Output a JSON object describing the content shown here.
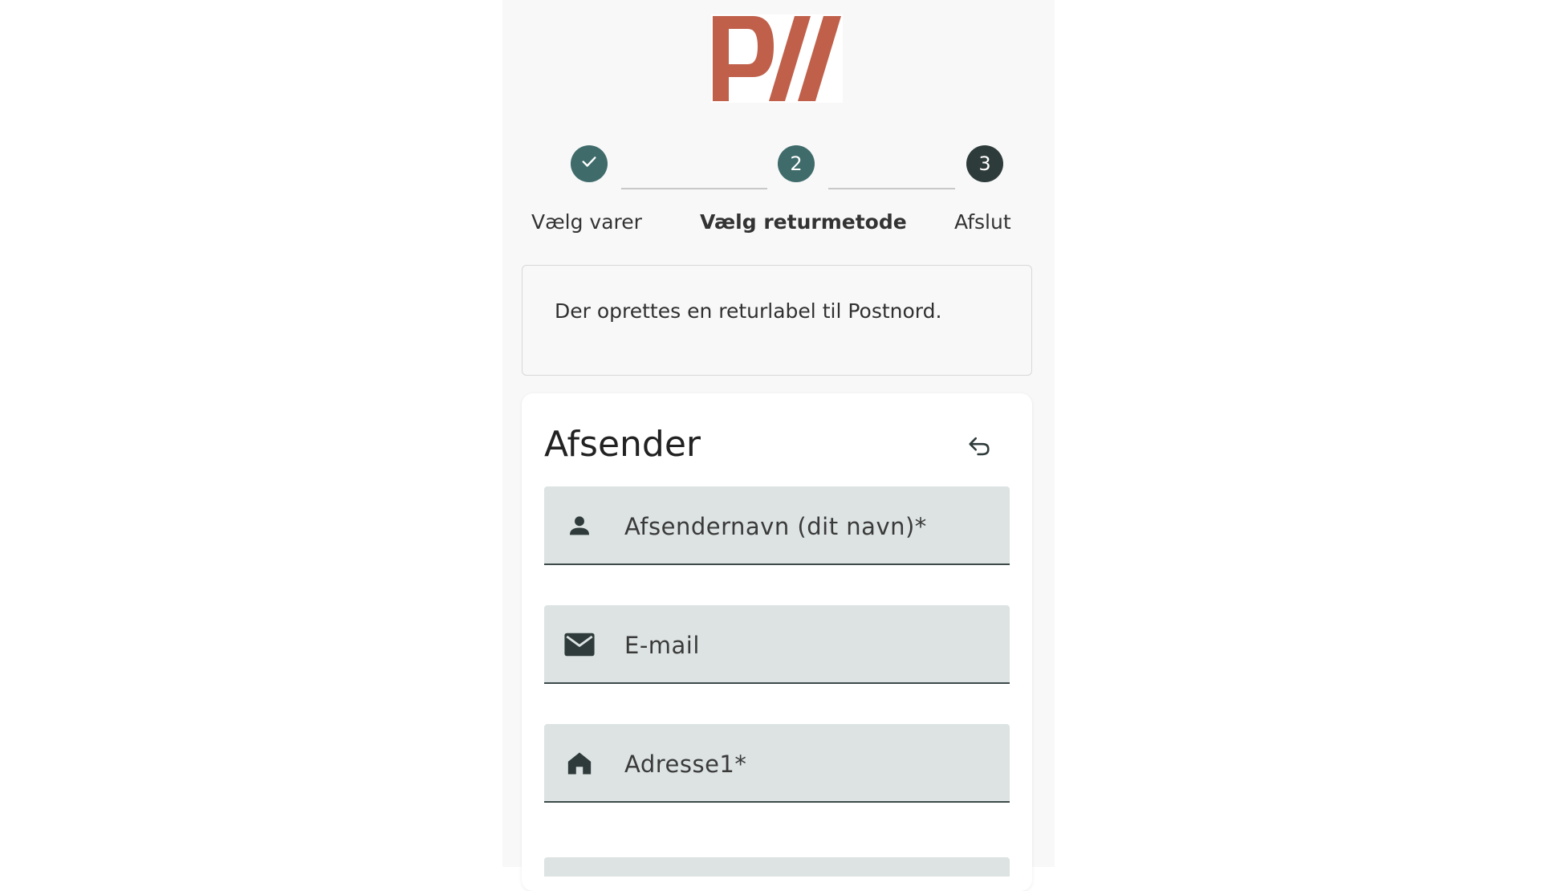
{
  "brand": {
    "logo_text": "PW",
    "color": "#c0604a"
  },
  "stepper": {
    "steps": [
      {
        "label": "Vælg varer",
        "state": "done",
        "icon": "check-icon",
        "color": "#3f6b6b"
      },
      {
        "label": "Vælg returmetode",
        "number": "2",
        "state": "active",
        "color": "#3f6b6b"
      },
      {
        "label": "Afslut",
        "number": "3",
        "state": "pending",
        "color": "#2e3b3b"
      }
    ]
  },
  "info": {
    "text": "Der oprettes en returlabel til Postnord."
  },
  "sender": {
    "title": "Afsender",
    "reset_icon": "undo-icon",
    "fields": [
      {
        "label": "Afsendernavn (dit navn)*",
        "icon": "person-icon"
      },
      {
        "label": "E-mail",
        "icon": "mail-icon"
      },
      {
        "label": "Adresse1*",
        "icon": "home-icon"
      }
    ]
  }
}
